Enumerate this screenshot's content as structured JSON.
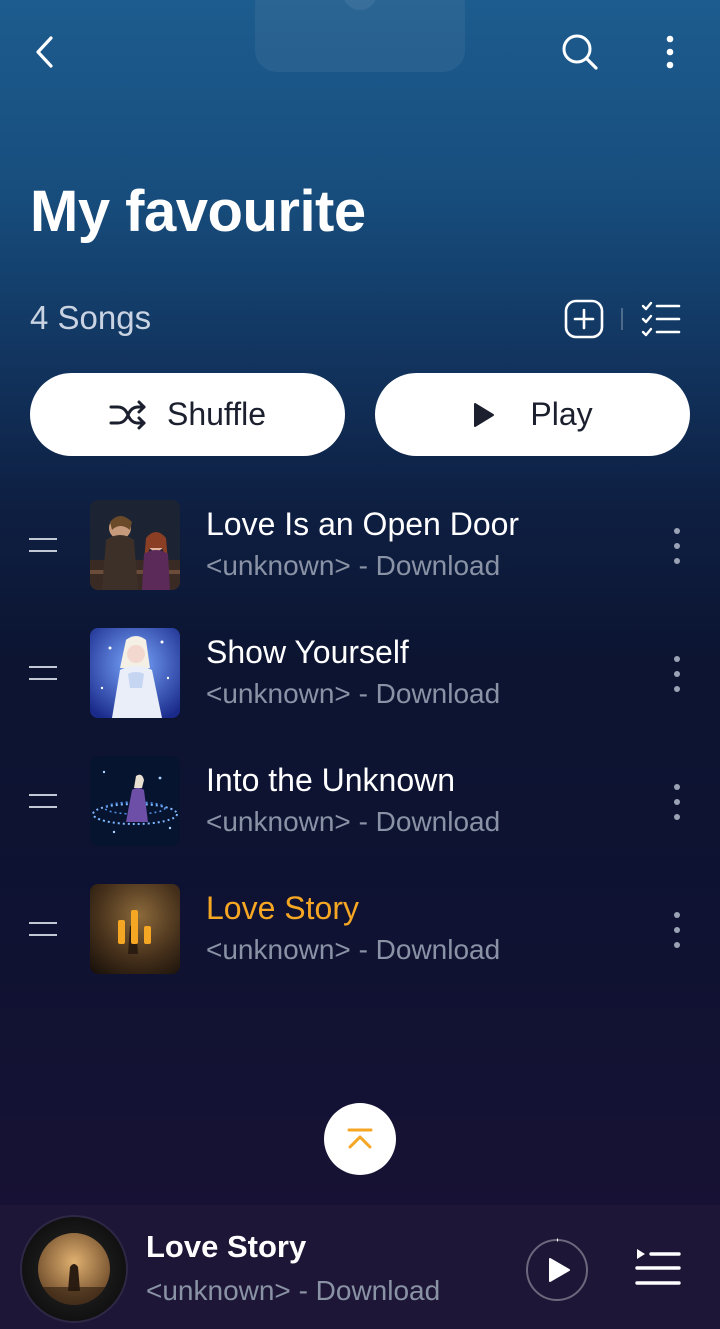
{
  "header": {
    "back_icon": "chevron-left-icon",
    "search_icon": "search-icon",
    "more_icon": "more-vertical-icon"
  },
  "playlist": {
    "title": "My favourite",
    "count": "4 Songs",
    "add_icon": "add-square-icon",
    "sort_icon": "checklist-icon"
  },
  "actions": {
    "shuffle_label": "Shuffle",
    "play_label": "Play"
  },
  "songs": [
    {
      "title": "Love Is an Open Door",
      "subtitle": "<unknown> - Download",
      "playing": false
    },
    {
      "title": "Show Yourself",
      "subtitle": "<unknown> - Download",
      "playing": false
    },
    {
      "title": "Into the Unknown",
      "subtitle": "<unknown> - Download",
      "playing": false
    },
    {
      "title": "Love Story",
      "subtitle": "<unknown> - Download",
      "playing": true
    }
  ],
  "mini_player": {
    "title": "Love Story",
    "subtitle": "<unknown> - Download"
  },
  "colors": {
    "accent": "#f5a623",
    "background_top": "#1d5c8e",
    "background_bottom": "#1b1236"
  }
}
